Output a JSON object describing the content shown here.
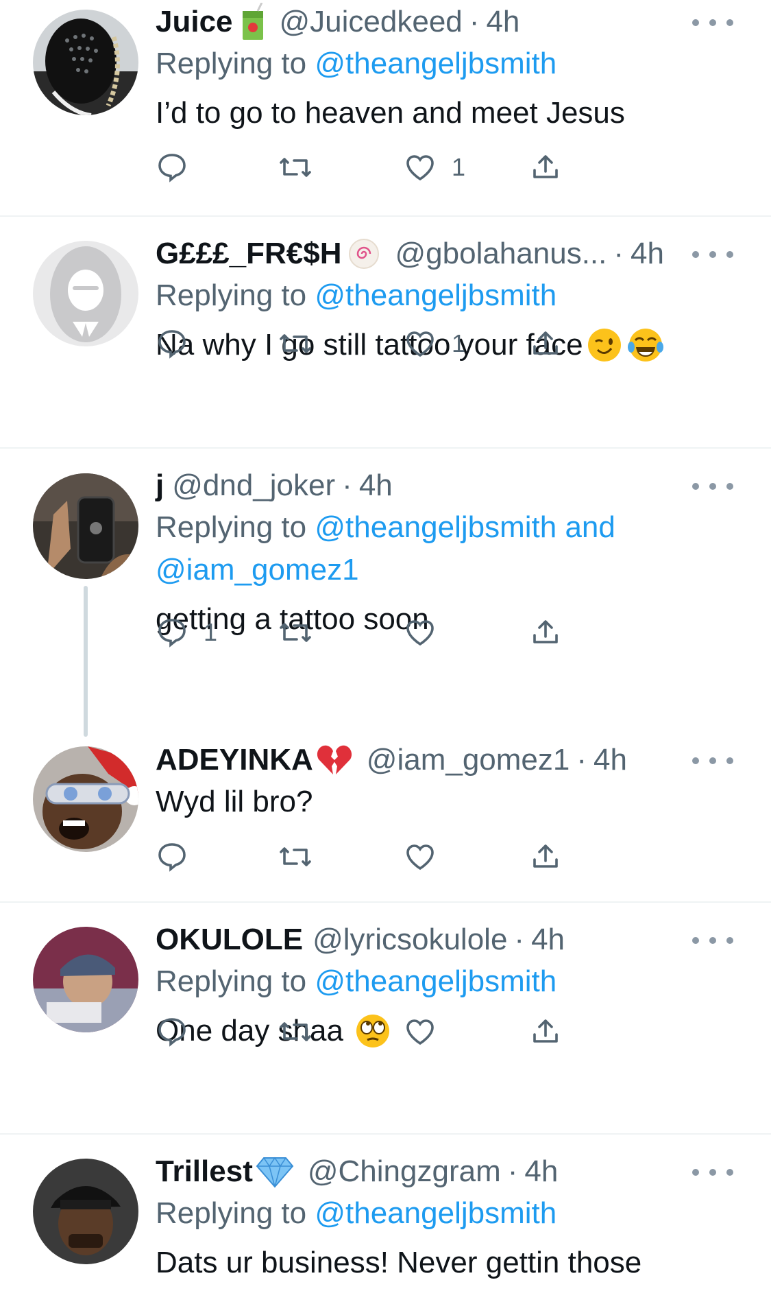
{
  "tweets": [
    {
      "name": "Juice",
      "name_emoji": "juice-box-emoji",
      "handle": "@Juicedkeed",
      "time": "4h",
      "replying_prefix": "Replying to",
      "replying_to": "@theangeljbsmith",
      "replying_to_extra": "",
      "text": "I’d to go to heaven and meet Jesus",
      "reply_count": "",
      "like_count": "1"
    },
    {
      "name": "G£££_FR€$H",
      "name_emoji": "fish-cake-emoji",
      "handle": "@gbolahanus...",
      "time": "4h",
      "replying_prefix": "Replying to",
      "replying_to": "@theangeljbsmith",
      "replying_to_extra": "",
      "text": "Na why I go still tattoo your face",
      "text_emojis": [
        "winking-face-emoji",
        "tears-of-joy-emoji"
      ],
      "reply_count": "",
      "like_count": "1"
    },
    {
      "name": "j",
      "handle": "@dnd_joker",
      "time": "4h",
      "replying_prefix": "Replying to",
      "replying_to": "@theangeljbsmith and",
      "replying_to_extra": "@iam_gomez1",
      "text": "getting a tattoo soon",
      "reply_count": "1",
      "like_count": ""
    },
    {
      "name": "ADEYINKA",
      "name_emoji": "broken-heart-emoji",
      "handle": "@iam_gomez1",
      "time": "4h",
      "text": "Wyd lil bro?",
      "reply_count": "",
      "like_count": ""
    },
    {
      "name": "OKULOLE",
      "handle": "@lyricsokulole",
      "time": "4h",
      "replying_prefix": "Replying to",
      "replying_to": "@theangeljbsmith",
      "text": "One day shaa",
      "text_emojis": [
        "eye-roll-emoji"
      ],
      "reply_count": "",
      "like_count": ""
    },
    {
      "name": "Trillest",
      "name_emoji": "gem-emoji",
      "handle": "@Chingzgram",
      "time": "4h",
      "replying_prefix": "Replying to",
      "replying_to": "@theangeljbsmith",
      "text": "Dats ur business! Never gettin those",
      "reply_count": "",
      "like_count": ""
    }
  ],
  "separator": "·",
  "colors": {
    "link": "#1d9bf0",
    "muted": "#536471",
    "text": "#0f1419",
    "divider": "#eff3f4",
    "thread_line": "#cfd9de"
  },
  "icons": [
    "reply-icon",
    "retweet-icon",
    "like-icon",
    "share-icon",
    "more-icon"
  ]
}
